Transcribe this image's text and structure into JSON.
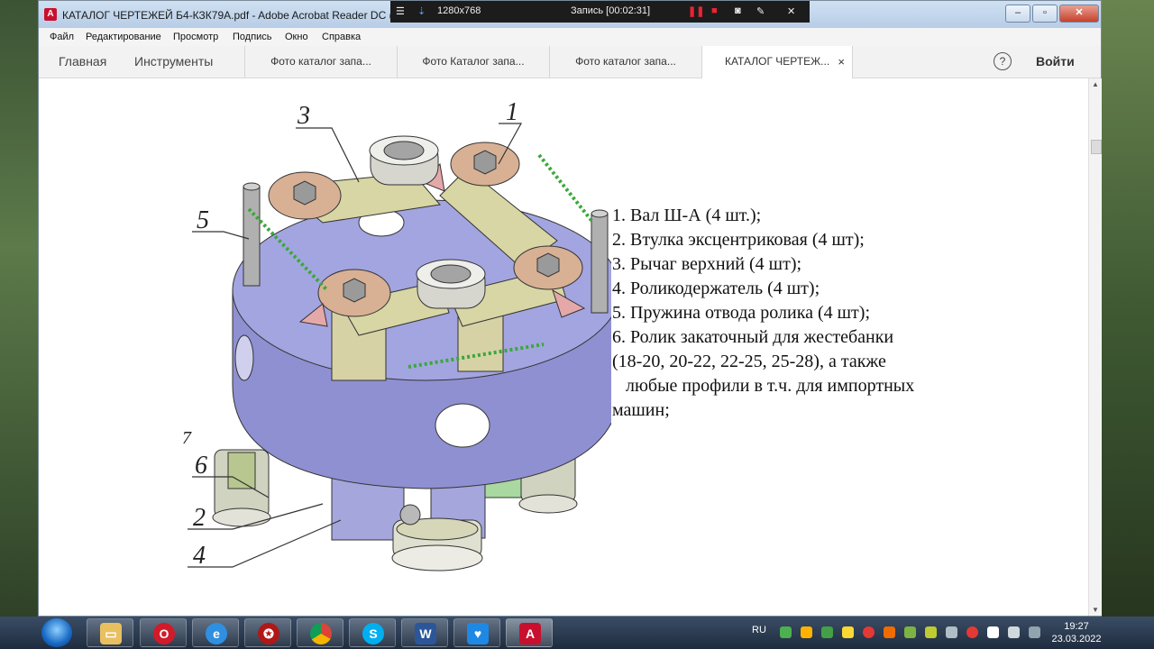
{
  "window": {
    "title": "КАТАЛОГ ЧЕРТЕЖЕЙ Б4-КЗК79А.pdf - Adobe Acrobat Reader DC (32-",
    "app_icon": "acrobat-icon"
  },
  "recorder": {
    "resolution": "1280x768",
    "status": "Запись [00:02:31]"
  },
  "menu": [
    "Файл",
    "Редактирование",
    "Просмотр",
    "Подпись",
    "Окно",
    "Справка"
  ],
  "tabs": {
    "home": "Главная",
    "tools": "Инструменты",
    "docs": [
      "Фото каталог запа...",
      "Фото Каталог запа...",
      "Фото каталог запа..."
    ],
    "active": "КАТАЛОГ ЧЕРТЕЖ...",
    "close": "×",
    "help": "?",
    "signin": "Войти"
  },
  "drawing": {
    "callouts": [
      "3",
      "1",
      "5",
      "7",
      "6",
      "2",
      "4"
    ]
  },
  "specs": [
    "1. Вал Ш-А (4 шт.);",
    "2. Втулка эксцентриковая (4 шт);",
    "3. Рычаг верхний (4 шт);",
    "4. Роликодержатель (4 шт);",
    "5. Пружина отвода ролика (4 шт);",
    "6. Ролик закаточный для жестебанки",
    "(18-20, 20-22, 22-25, 25-28), а также",
    "   любые профили в т.ч. для импортных",
    "машин;"
  ],
  "taskbar": {
    "apps": [
      "explorer-icon",
      "opera-icon",
      "ie-icon",
      "app-icon",
      "chrome-icon",
      "skype-icon",
      "word-icon",
      "heart-icon",
      "acrobat-icon"
    ],
    "lang": "RU",
    "time": "19:27",
    "date": "23.03.2022"
  }
}
